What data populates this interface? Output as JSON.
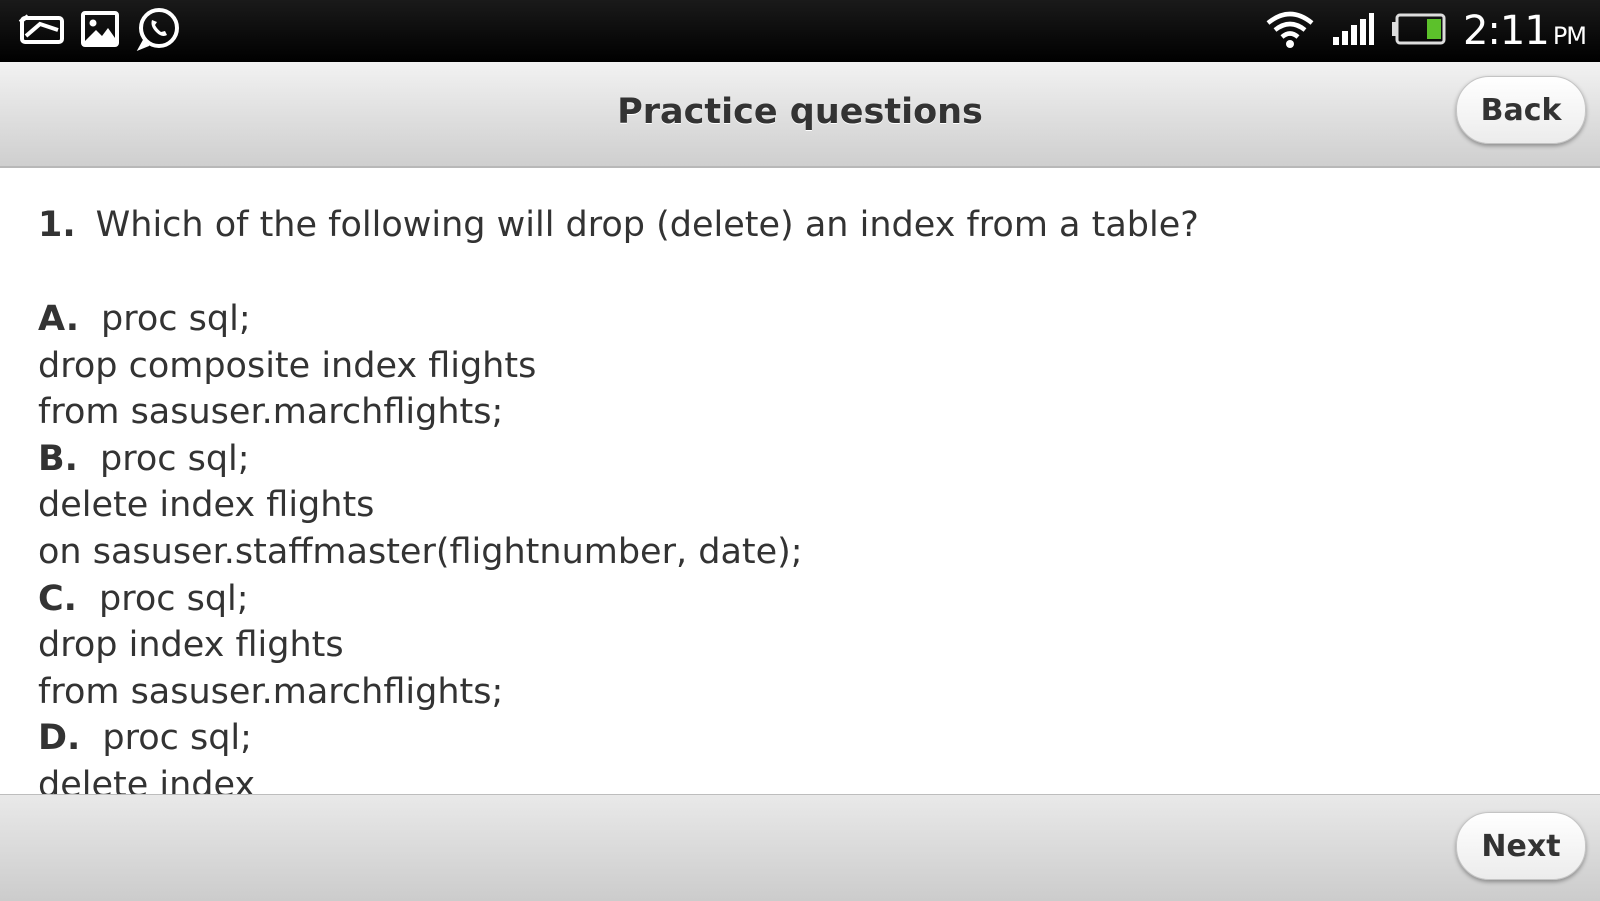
{
  "status_bar": {
    "time": "2:11",
    "ampm": "PM",
    "icons": [
      "message-icon",
      "gallery-icon",
      "whatsapp-icon",
      "wifi-icon",
      "signal-icon",
      "battery-icon"
    ]
  },
  "header": {
    "title": "Practice questions",
    "back_label": "Back"
  },
  "question": {
    "number": "1.",
    "text": "Which of the following will drop (delete) an index from a table?"
  },
  "options": [
    {
      "letter": "A.",
      "lines": [
        "proc sql;",
        "drop composite index flights",
        "from sasuser.marchflights;"
      ]
    },
    {
      "letter": "B.",
      "lines": [
        "proc sql;",
        "delete index flights",
        "on sasuser.staffmaster(flightnumber, date);"
      ]
    },
    {
      "letter": "C.",
      "lines": [
        "proc sql;",
        "drop index flights",
        "from sasuser.marchflights;"
      ]
    },
    {
      "letter": "D.",
      "lines": [
        "proc sql;",
        "delete index"
      ]
    }
  ],
  "footer": {
    "next_label": "Next"
  },
  "colors": {
    "status_bar_bg": "#000000",
    "header_bg": "#dedede",
    "text": "#333333",
    "battery_green": "#5cc12b"
  }
}
